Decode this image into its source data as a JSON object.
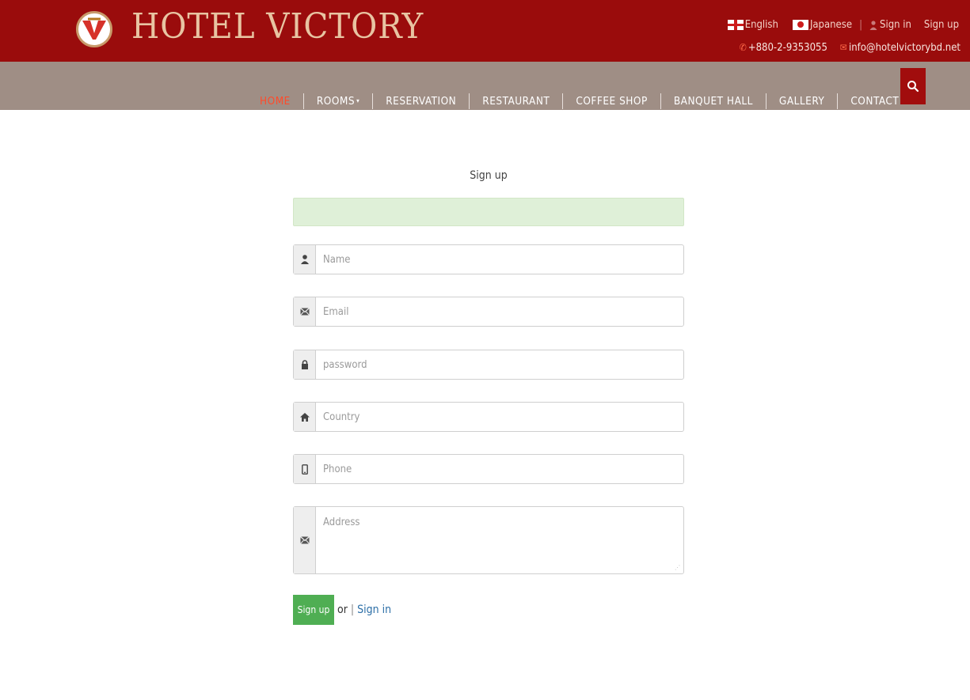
{
  "header": {
    "brand": "HOTEL VICTORY",
    "logo_icon": "victory-v-logo",
    "lang_english": "English",
    "lang_japanese": "Japanese",
    "signin": "Sign in",
    "signup": "Sign up",
    "phone": "+880-2-9353055",
    "email": "info@hotelvictorybd.net"
  },
  "nav": {
    "items": [
      "HOME",
      "ROOMS",
      "RESERVATION",
      "RESTAURANT",
      "COFFEE SHOP",
      "BANQUET HALL",
      "GALLERY",
      "CONTACT"
    ],
    "active": "HOME",
    "search_icon": "search-icon"
  },
  "form": {
    "title": "Sign up",
    "fields": {
      "name": {
        "placeholder": "Name",
        "icon": "user-icon"
      },
      "email": {
        "placeholder": "Email",
        "icon": "envelope-icon"
      },
      "password": {
        "placeholder": "password",
        "icon": "lock-icon"
      },
      "country": {
        "placeholder": "Country",
        "icon": "home-icon"
      },
      "phone": {
        "placeholder": "Phone",
        "icon": "mobile-phone-icon"
      },
      "address": {
        "placeholder": "Address",
        "icon": "envelope-icon"
      }
    },
    "submit_label": "Sign up",
    "or_text": "or",
    "signin_link": "Sign in"
  },
  "colors": {
    "header_red": "#9a0c0c",
    "nav_taupe": "#9f8e85",
    "active_nav": "#ff4b2b",
    "alert_green": "#dff0d8",
    "button_green": "#4fae53",
    "link_blue": "#2d6fa7"
  }
}
